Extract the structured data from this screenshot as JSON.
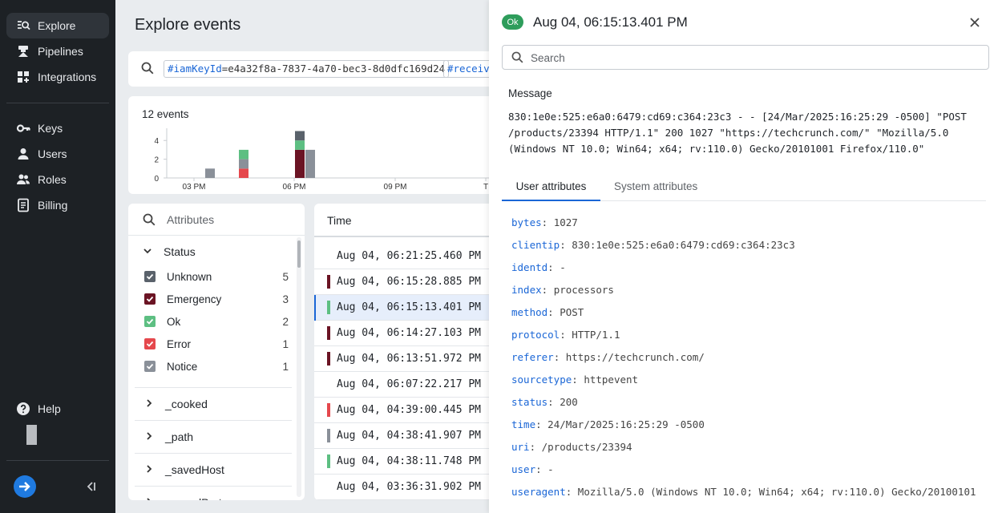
{
  "sidebar": {
    "items": [
      {
        "label": "Explore",
        "icon": "explore-icon"
      },
      {
        "label": "Pipelines",
        "icon": "pipelines-icon"
      },
      {
        "label": "Integrations",
        "icon": "integrations-icon"
      },
      {
        "label": "Keys",
        "icon": "key-icon"
      },
      {
        "label": "Users",
        "icon": "user-icon"
      },
      {
        "label": "Roles",
        "icon": "roles-icon"
      },
      {
        "label": "Billing",
        "icon": "billing-icon"
      }
    ],
    "help": "Help"
  },
  "main": {
    "title": "Explore events",
    "query_tags": [
      {
        "key": "#iamKeyId",
        "value": "=e4a32f8a-7837-4a70-bec3-8d0dfc169d24"
      },
      {
        "key": "#receiv",
        "value": ""
      }
    ],
    "events_count": "12 events",
    "colors": {
      "emergency": "#6b1424",
      "ok": "#5dbf82",
      "error": "#e5484d",
      "notice": "#8a9099",
      "unknown": "#5a626b",
      "accent": "#1a66d6"
    }
  },
  "chart_data": {
    "type": "bar",
    "stacked": true,
    "x_ticks": [
      "03 PM",
      "06 PM",
      "09 PM",
      "T"
    ],
    "y_ticks": [
      "0",
      "2",
      "4"
    ],
    "ylim": [
      0,
      5
    ],
    "bins": [
      {
        "x": "~03:30 PM",
        "stack": [
          {
            "status": "Notice",
            "value": 1
          }
        ]
      },
      {
        "x": "~04:30 PM",
        "stack": [
          {
            "status": "Error",
            "value": 1
          },
          {
            "status": "Notice",
            "value": 1
          },
          {
            "status": "Ok",
            "value": 1
          }
        ]
      },
      {
        "x": "~06:00 PM",
        "stack": [
          {
            "status": "Emergency",
            "value": 3
          },
          {
            "status": "Ok",
            "value": 1
          },
          {
            "status": "Unknown",
            "value": 1
          }
        ]
      },
      {
        "x": "~06:20 PM",
        "stack": [
          {
            "status": "Notice",
            "value": 3
          }
        ]
      }
    ]
  },
  "attributes": {
    "search_placeholder": "Attributes",
    "status_label": "Status",
    "statuses": [
      {
        "label": "Unknown",
        "count": "5",
        "color": "#5a626b"
      },
      {
        "label": "Emergency",
        "count": "3",
        "color": "#6b1424"
      },
      {
        "label": "Ok",
        "count": "2",
        "color": "#5dbf82"
      },
      {
        "label": "Error",
        "count": "1",
        "color": "#e5484d"
      },
      {
        "label": "Notice",
        "count": "1",
        "color": "#8a9099"
      }
    ],
    "groups": [
      "_cooked",
      "_path",
      "_savedHost",
      "_savedPort"
    ]
  },
  "events": {
    "header": "Time",
    "rows": [
      {
        "time": "Aug 04, 06:21:25.460 PM",
        "status": "Unknown",
        "color": ""
      },
      {
        "time": "Aug 04, 06:15:28.885 PM",
        "status": "Emergency",
        "color": "#6b1424"
      },
      {
        "time": "Aug 04, 06:15:13.401 PM",
        "status": "Ok",
        "color": "#5dbf82",
        "selected": true
      },
      {
        "time": "Aug 04, 06:14:27.103 PM",
        "status": "Emergency",
        "color": "#6b1424"
      },
      {
        "time": "Aug 04, 06:13:51.972 PM",
        "status": "Emergency",
        "color": "#6b1424"
      },
      {
        "time": "Aug 04, 06:07:22.217 PM",
        "status": "Unknown",
        "color": ""
      },
      {
        "time": "Aug 04, 04:39:00.445 PM",
        "status": "Error",
        "color": "#e5484d"
      },
      {
        "time": "Aug 04, 04:38:41.907 PM",
        "status": "Notice",
        "color": "#8a9099"
      },
      {
        "time": "Aug 04, 04:38:11.748 PM",
        "status": "Ok",
        "color": "#5dbf82"
      },
      {
        "time": "Aug 04, 03:36:31.902 PM",
        "status": "Unknown",
        "color": ""
      }
    ]
  },
  "detail": {
    "status_badge": "Ok",
    "title": "Aug 04, 06:15:13.401 PM",
    "search_placeholder": "Search",
    "message_label": "Message",
    "message": "830:1e0e:525:e6a0:6479:cd69:c364:23c3 - - [24/Mar/2025:16:25:29 -0500] \"POST /products/23394 HTTP/1.1\" 200 1027 \"https://techcrunch.com/\" \"Mozilla/5.0 (Windows NT 10.0; Win64; x64; rv:110.0) Gecko/20101001 Firefox/110.0\"",
    "tabs": [
      "User attributes",
      "System attributes"
    ],
    "attributes": [
      {
        "key": "bytes",
        "value": "1027"
      },
      {
        "key": "clientip",
        "value": "830:1e0e:525:e6a0:6479:cd69:c364:23c3"
      },
      {
        "key": "identd",
        "value": "-"
      },
      {
        "key": "index",
        "value": "processors"
      },
      {
        "key": "method",
        "value": "POST"
      },
      {
        "key": "protocol",
        "value": "HTTP/1.1"
      },
      {
        "key": "referer",
        "value": "https://techcrunch.com/"
      },
      {
        "key": "sourcetype",
        "value": "httpevent"
      },
      {
        "key": "status",
        "value": "200"
      },
      {
        "key": "time",
        "value": "24/Mar/2025:16:25:29 -0500"
      },
      {
        "key": "uri",
        "value": "/products/23394"
      },
      {
        "key": "user",
        "value": "-"
      },
      {
        "key": "useragent",
        "value": "Mozilla/5.0 (Windows NT 10.0; Win64; x64; rv:110.0) Gecko/20100101"
      }
    ]
  }
}
